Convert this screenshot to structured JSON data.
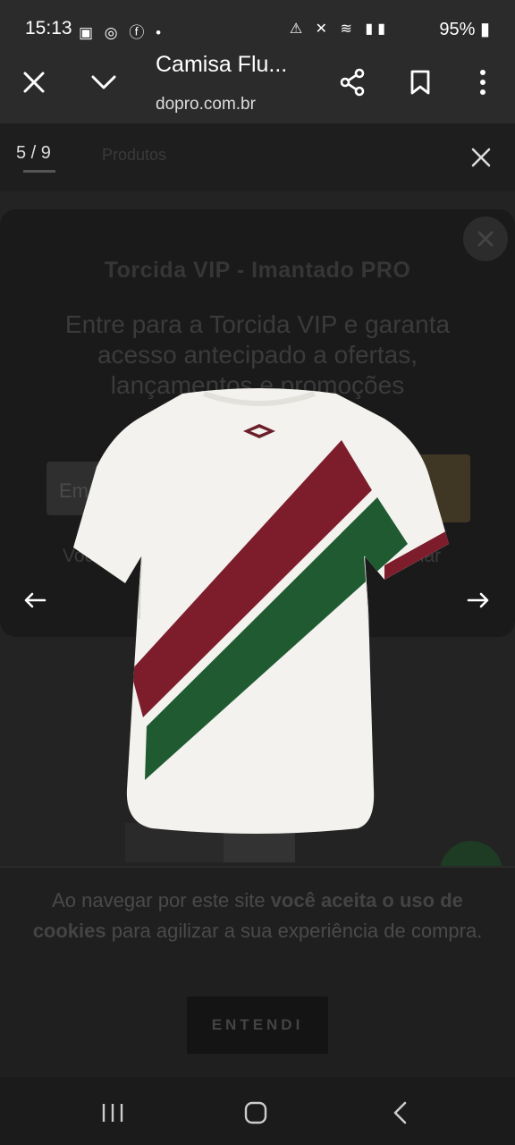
{
  "status_bar": {
    "time": "15:13",
    "battery": "95%",
    "notif_icons": "▣ ◎ ⓕ •",
    "sys_icons": "⚠ ✕ ≋ ▮▮"
  },
  "browser": {
    "title": "Camisa Flu...",
    "url": "dopro.com.br"
  },
  "gallery": {
    "counter": "5 / 9",
    "ghost_label": "Produtos"
  },
  "popup": {
    "title": "Torcida VIP - Imantado PRO",
    "text": "Entre para a Torcida VIP e garanta acesso antecipado a ofertas, lançamentos e promoções especiais!",
    "email_placeholder": "Email",
    "submit_label": "O",
    "foot_left": "Você",
    "foot_right": "rmar"
  },
  "cookie": {
    "text_prefix": "Ao navegar por este site ",
    "text_bold": "você aceita o uso de cookies",
    "text_suffix": " para agilizar a sua experiência de compra.",
    "button": "ENTENDI"
  },
  "colors": {
    "stripe_red": "#7d1d2c",
    "stripe_green": "#1f5a30",
    "shirt": "#f3f2ee"
  }
}
